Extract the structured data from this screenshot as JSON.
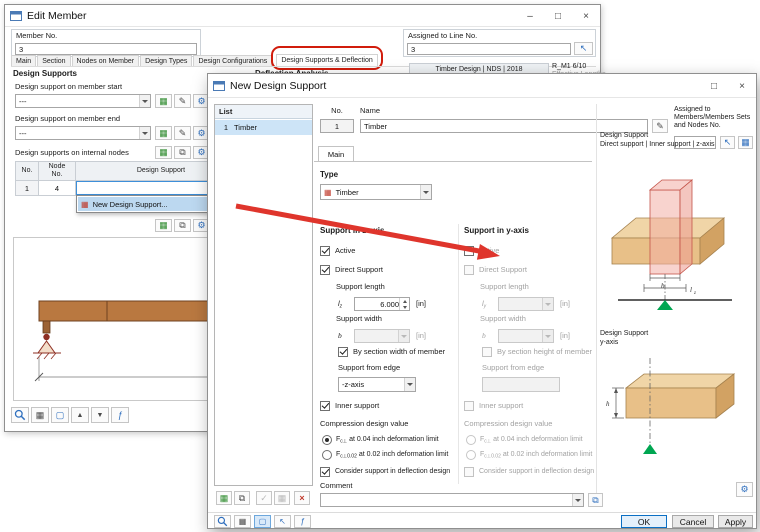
{
  "icons": {
    "min": "–",
    "max": "□",
    "close": "×",
    "grid": "▦",
    "copy": "⧉",
    "gear": "⚙",
    "edit": "✎",
    "pick": "↖",
    "fx": "ƒ",
    "box": "▢",
    "up": "▲",
    "down": "▼",
    "del": "×",
    "chk": "✓"
  },
  "colors": {
    "accent": "#0078d7",
    "selection": "#cde4f7",
    "annotation": "#d11c0c",
    "arrow": "#df352c",
    "beam": "#b97840",
    "support_red": "#8e2f23",
    "wood_top": "#f0d5a7",
    "wood_front": "#e8c088",
    "wood_end": "#d2a263",
    "pink": "#f2afa6",
    "green": "#00a651"
  },
  "back": {
    "title": "Edit Member",
    "member_no": {
      "label": "Member No.",
      "value": "3"
    },
    "line_no": {
      "label": "Assigned to Line No.",
      "value": "3"
    },
    "tabs": [
      "Main",
      "Section",
      "Nodes on Member",
      "Design Types",
      "Design Configurations",
      "Design Supports & Deflection"
    ],
    "ds": {
      "title": "Design Supports",
      "start_label": "Design support on member start",
      "start_value": "---",
      "end_label": "Design support on member end",
      "end_value": "---",
      "internal_label": "Design supports on internal nodes",
      "col_no": "No.",
      "col_node1": "Node",
      "col_node2": "No.",
      "col_support": "Design Support",
      "row_no": "1",
      "row_node": "4",
      "new_item": "New Design Support..."
    },
    "defl": {
      "title": "Deflection Analysis",
      "header": "Timber Design | NDS | 2018",
      "config": "R_M1 6/10",
      "sub": "Effective Lengths"
    }
  },
  "dialog": {
    "title": "New Design Support",
    "list": {
      "header": "List",
      "item_no": "1",
      "item_name": "Timber"
    },
    "no": {
      "label": "No.",
      "value": "1"
    },
    "name": {
      "label": "Name",
      "value": "Timber"
    },
    "assigned": {
      "label": "Assigned to Members/Members Sets and Nodes No."
    },
    "tab": "Main",
    "type": {
      "label": "Type",
      "value": "Timber"
    },
    "z": {
      "title": "Support in z-axis",
      "active": "Active",
      "direct": "Direct Support",
      "len_label": "Support length",
      "len_sym": "l",
      "len_sub": "z",
      "len_val": "6.000",
      "len_unit": "[in]",
      "wid_label": "Support width",
      "wid_sym": "b",
      "wid_unit": "[in]",
      "bysec": "By section width of member",
      "edge_label": "Support from edge",
      "edge_val": "-z-axis",
      "inner": "Inner support",
      "comp": "Compression design value",
      "r1a": "F",
      "r1s": "c⊥",
      "r1b": " at 0.04 inch deformation limit",
      "r2a": "F",
      "r2s": "c⊥0.02",
      "r2b": " at 0.02 inch deformation limit",
      "defl": "Consider support in deflection design"
    },
    "y": {
      "title": "Support in y-axis",
      "active": "Active",
      "direct": "Direct Support",
      "len_label": "Support length",
      "len_sym": "l",
      "len_sub": "y",
      "len_unit": "[in]",
      "wid_label": "Support width",
      "wid_sym": "b",
      "wid_unit": "[in]",
      "bysec": "By section height of member",
      "edge_label": "Support from edge",
      "inner": "Inner support",
      "comp": "Compression design value",
      "r1a": "F",
      "r1s": "c⊥",
      "r1b": " at 0.04 inch deformation limit",
      "r2a": "F",
      "r2s": "c⊥0.02",
      "r2b": " at 0.02 inch deformation limit",
      "defl": "Consider support in deflection design"
    },
    "pv": {
      "t1": "Design Support",
      "s1": "Direct support | Inner support | z-axis",
      "t2": "Design Support",
      "s2": "y-axis",
      "b": "b",
      "l": "l",
      "lsub": "z",
      "h": "h"
    },
    "comment_label": "Comment",
    "ok": "OK",
    "cancel": "Cancel",
    "apply": "Apply"
  }
}
